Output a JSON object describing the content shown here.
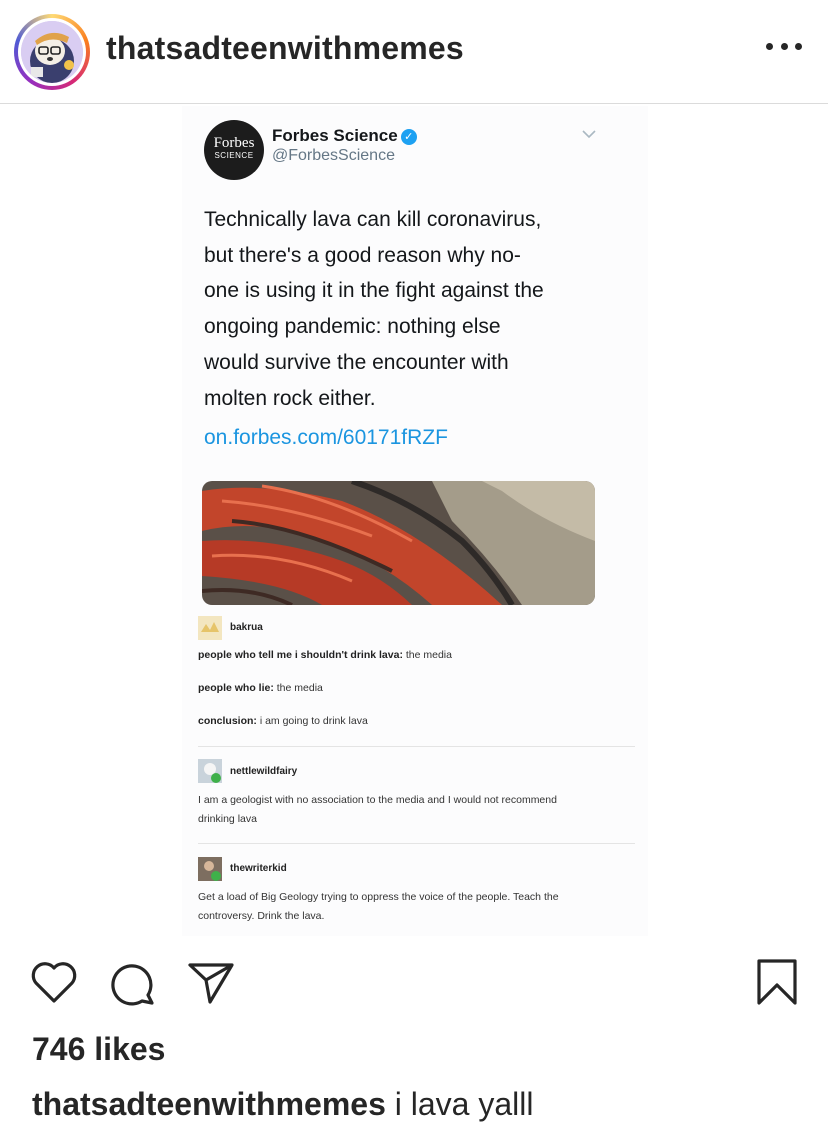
{
  "header": {
    "username": "thatsadteenwithmemes",
    "avatar_icon": "cartoon-character-avatar",
    "more_icon": "more-options-icon"
  },
  "post_image": {
    "tweet": {
      "avatar_logo": "Forbes",
      "avatar_sub": "SCIENCE",
      "name": "Forbes Science",
      "verified_icon": "verified-badge-icon",
      "handle": "@ForbesScience",
      "text_lines": [
        "Technically lava can kill coronavirus,",
        "but there's a good reason why no-",
        "one is using it in the fight against the",
        "ongoing pandemic: nothing else",
        "would survive the encounter with",
        "molten rock either."
      ],
      "link": "on.forbes.com/60171fRZF"
    },
    "tumblr": [
      {
        "username": "bakrua",
        "lines": [
          {
            "bold": "people who tell me i shouldn't drink lava:",
            "text": " the media"
          },
          {
            "bold": "people who lie:",
            "text": " the media"
          },
          {
            "bold": "conclusion:",
            "text": " i am going to drink lava"
          }
        ]
      },
      {
        "username": "nettlewildfairy",
        "lines": [
          {
            "bold": "",
            "text": "I am a geologist with no association to the media and I would not recommend"
          },
          {
            "bold": "",
            "text": "drinking lava"
          }
        ]
      },
      {
        "username": "thewriterkid",
        "lines": [
          {
            "bold": "",
            "text": "Get a load of Big Geology trying to oppress the voice of the people. Teach the"
          },
          {
            "bold": "",
            "text": "controversy. Drink the lava."
          }
        ]
      }
    ]
  },
  "actions": {
    "like_icon": "heart-icon",
    "comment_icon": "comment-icon",
    "share_icon": "send-icon",
    "save_icon": "bookmark-icon"
  },
  "likes": "746 likes",
  "caption": {
    "username": "thatsadteenwithmemes",
    "text": " i lava yalll"
  },
  "colors": {
    "text": "#262626",
    "link_blue": "#1b95e0",
    "verified_blue": "#1da1f2",
    "divider": "#dbdbdb"
  }
}
